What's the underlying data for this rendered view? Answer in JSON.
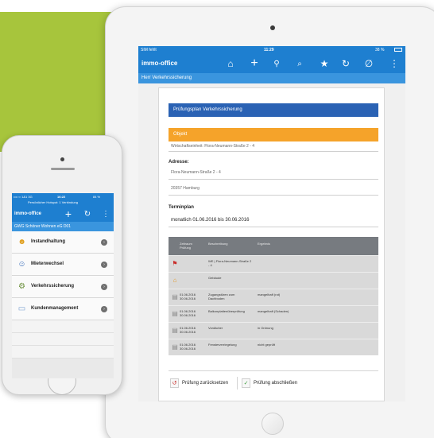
{
  "ipad": {
    "status": {
      "carrier": "SIM fehlt",
      "time": "11:29",
      "battery": "38 %"
    },
    "app_title": "immo-office",
    "toolbar_icons": [
      "home-icon",
      "plus-icon",
      "pin-icon",
      "search-icon",
      "star-icon",
      "sync-icon",
      "paperclip-icon",
      "more-icon"
    ],
    "subtitle": "Herr Verkehrssicherung",
    "doc": {
      "plan_title": "Prüfungsplan Verkehrssicherung",
      "objekt_label": "Objekt",
      "objekt_value": "Wirtschaftseinheit: Flora-Neumann-Straße 2 - 4",
      "adresse_label": "Adresse:",
      "street": "Flora-Neumann-Straße 2 - 4",
      "city": "20357 Hamburg",
      "terminplan_label": "Terminplan",
      "terminplan_value": "monatlich 01.06.2016 bis 30.06.2016",
      "grid_head": {
        "col1": "Zeitraum Prüfung",
        "col2": "Beschreibung",
        "col3": "Ergebnis"
      },
      "rows": [
        {
          "icon": "pin-icon",
          "date": "",
          "desc": "WE | Flora-Neumann-Straße 2 - 4",
          "result": ""
        },
        {
          "icon": "building-icon",
          "date": "",
          "desc": "Gebäude",
          "result": ""
        },
        {
          "icon": "doc-icon",
          "date": "01.06.2016 30.06.2016",
          "desc": "Zugangstüren zum Dachboden",
          "result": "mangelhaft (rot)"
        },
        {
          "icon": "doc-icon",
          "date": "01.06.2016 30.06.2016",
          "desc": "Balkonplattenüberprüfung",
          "result": "mangelhaft (Schaden)"
        },
        {
          "icon": "doc-icon",
          "date": "01.06.2016 30.06.2016",
          "desc": "Vordächer",
          "result": "in Ordnung"
        },
        {
          "icon": "doc-icon",
          "date": "01.06.2016 30.06.2016",
          "desc": "Fensterverriegelung",
          "result": "nicht geprüft"
        }
      ],
      "btn_reset": "Prüfung zurücksetzen",
      "btn_finish": "Prüfung abschließen"
    }
  },
  "iphone": {
    "status": {
      "carrier": "•••○○ 1&1 3G",
      "time": "16:22",
      "battery": "84 %",
      "hotspot": "Persönlicher Hotspot: 1 Verbindung"
    },
    "app_title": "immo-office",
    "subtitle": "GWG Schöner Wohnen eG D01",
    "menu": [
      {
        "icon": "worker-icon",
        "label": "Instandhaltung"
      },
      {
        "icon": "people-icon",
        "label": "Mieterwechsel"
      },
      {
        "icon": "gear-icon",
        "label": "Verkehrssicherung"
      },
      {
        "icon": "card-icon",
        "label": "Kundenmanagement"
      }
    ]
  }
}
